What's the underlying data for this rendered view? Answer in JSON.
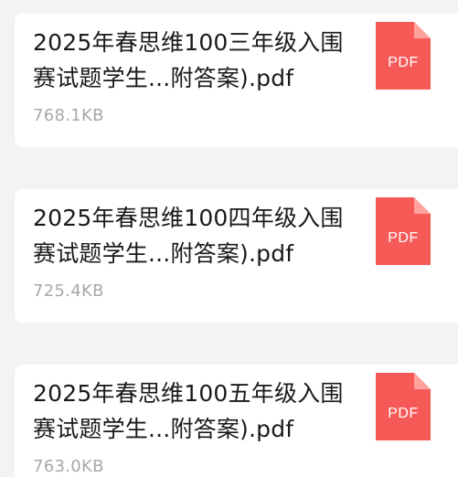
{
  "files": [
    {
      "name": "2025年春思维100三年级入围赛试题学生...附答案).pdf",
      "size": "768.1KB",
      "icon": "pdf-file-icon",
      "icon_label": "PDF"
    },
    {
      "name": "2025年春思维100四年级入围赛试题学生...附答案).pdf",
      "size": "725.4KB",
      "icon": "pdf-file-icon",
      "icon_label": "PDF"
    },
    {
      "name": "2025年春思维100五年级入围赛试题学生...附答案).pdf",
      "size": "763.0KB",
      "icon": "pdf-file-icon",
      "icon_label": "PDF"
    }
  ],
  "colors": {
    "background": "#f3f3f5",
    "card": "#ffffff",
    "pdf_icon": "#f55a57",
    "pdf_icon_fold": "#ffa19c",
    "name_text": "#1a1a1a",
    "size_text": "#a8a8a8"
  }
}
